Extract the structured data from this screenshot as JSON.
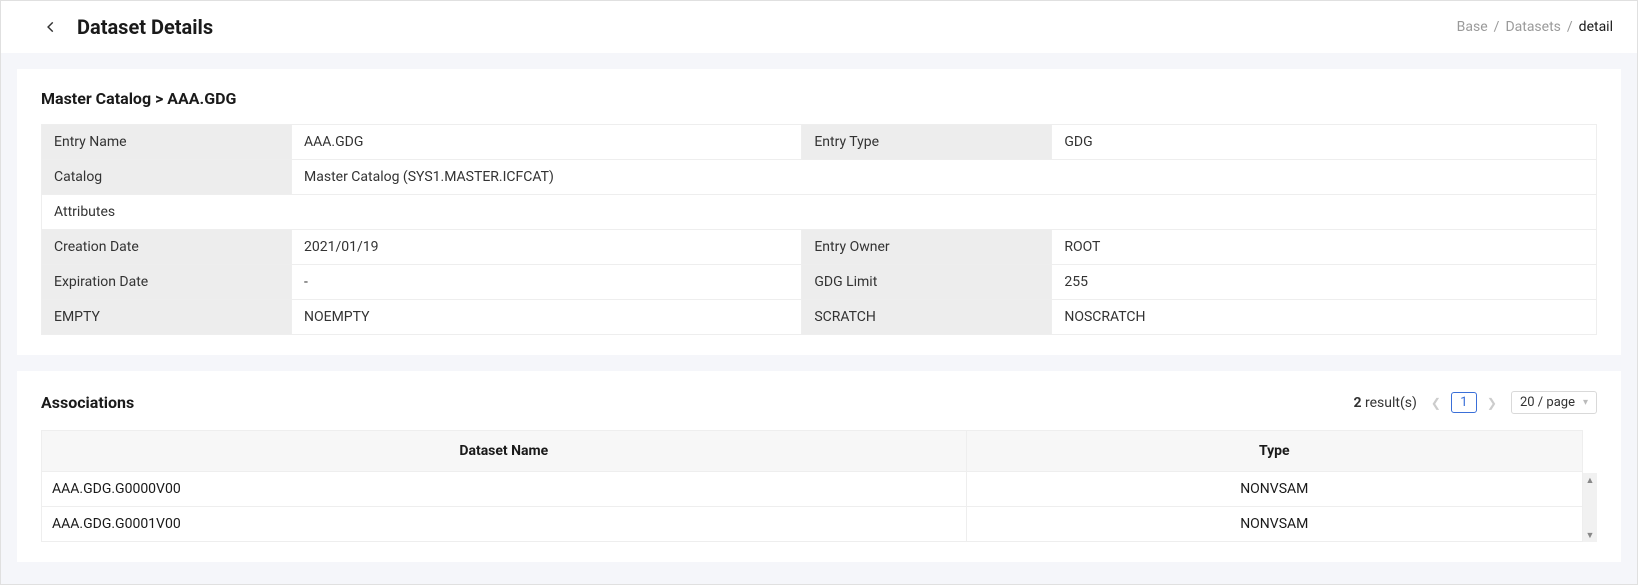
{
  "header": {
    "title": "Dataset Details"
  },
  "breadcrumb": {
    "base": "Base",
    "datasets": "Datasets",
    "current": "detail"
  },
  "catalog_path": "Master Catalog > AAA.GDG",
  "details": {
    "entry_name_label": "Entry Name",
    "entry_name_value": "AAA.GDG",
    "entry_type_label": "Entry Type",
    "entry_type_value": "GDG",
    "catalog_label": "Catalog",
    "catalog_value": "Master Catalog (SYS1.MASTER.ICFCAT)",
    "attributes_label": "Attributes",
    "creation_date_label": "Creation Date",
    "creation_date_value": "2021/01/19",
    "entry_owner_label": "Entry Owner",
    "entry_owner_value": "ROOT",
    "expiration_date_label": "Expiration Date",
    "expiration_date_value": "-",
    "gdg_limit_label": "GDG Limit",
    "gdg_limit_value": "255",
    "empty_label": "EMPTY",
    "empty_value": "NOEMPTY",
    "scratch_label": "SCRATCH",
    "scratch_value": "NOSCRATCH"
  },
  "associations": {
    "title": "Associations",
    "result_count": "2",
    "result_suffix": " result(s)",
    "current_page": "1",
    "page_size": "20 / page",
    "columns": {
      "dataset_name": "Dataset Name",
      "type": "Type"
    },
    "rows": [
      {
        "name": "AAA.GDG.G0000V00",
        "type": "NONVSAM"
      },
      {
        "name": "AAA.GDG.G0001V00",
        "type": "NONVSAM"
      }
    ]
  }
}
